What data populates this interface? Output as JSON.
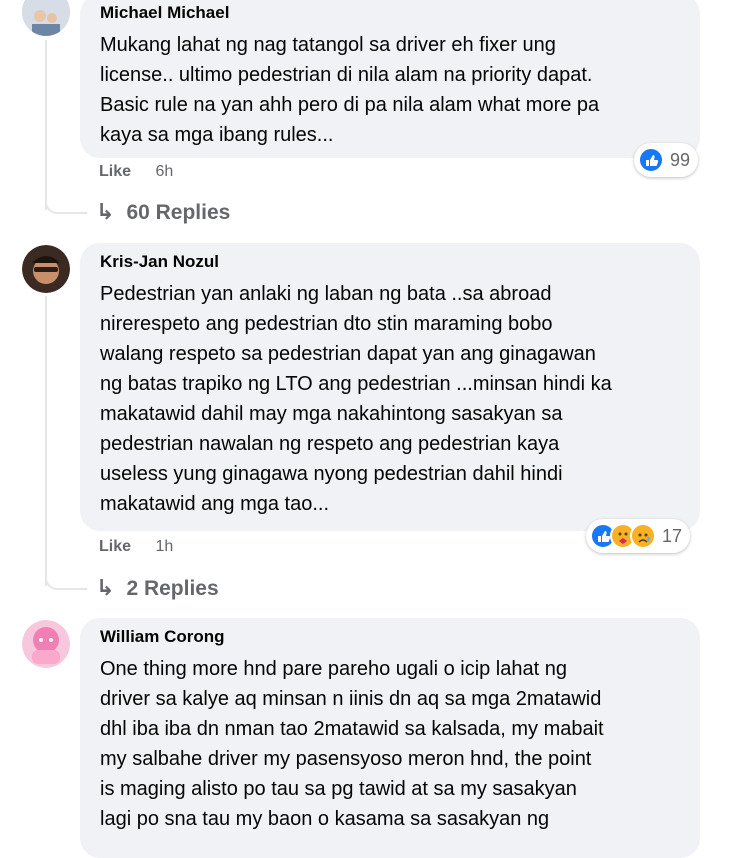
{
  "comments": [
    {
      "author": "Michael Michael",
      "text": "Mukang lahat ng nag tatangol sa driver eh fixer ung\nlicense.. ultimo pedestrian di nila alam na priority dapat.\nBasic rule na yan ahh pero di pa nila alam what more pa\nkaya sa mga ibang rules...",
      "like_label": "Like",
      "time": "6h",
      "reaction_count": "99",
      "replies_label": "60 Replies"
    },
    {
      "author": "Kris-Jan Nozul",
      "text": "Pedestrian yan anlaki ng laban ng bata ..sa abroad\nnirerespeto ang pedestrian dto stin maraming bobo\nwalang respeto sa pedestrian dapat yan ang ginagawan\nng batas trapiko ng LTO ang pedestrian ...minsan hindi ka\nmakatawid dahil may mga nakahintong sasakyan sa\npedestrian nawalan ng respeto ang pedestrian kaya\nuseless yung ginagawa nyong pedestrian dahil hindi\nmakatawid ang mga tao...",
      "like_label": "Like",
      "time": "1h",
      "reaction_count": "17",
      "replies_label": "2 Replies"
    },
    {
      "author": "William Corong",
      "text": "One thing more hnd pare pareho ugali o icip lahat ng\ndriver sa kalye aq minsan n iinis dn aq sa mga 2matawid\ndhl iba iba dn nman tao 2matawid sa kalsada, my mabait\nmy salbahe driver my pasensyoso meron hnd, the point\nis maging alisto po tau sa pg tawid at sa my sasakyan\nlagi po sna tau my baon o kasama sa sasakyan ng"
    }
  ],
  "colors": {
    "bubble": "#f0f2f5",
    "like_blue": "#1877f2",
    "meta_gray": "#65676b"
  },
  "icons": {
    "reply_arrow": "reply-arrow-icon",
    "like": "like-reaction-icon",
    "care": "care-reaction-icon",
    "sad": "sad-reaction-icon"
  }
}
